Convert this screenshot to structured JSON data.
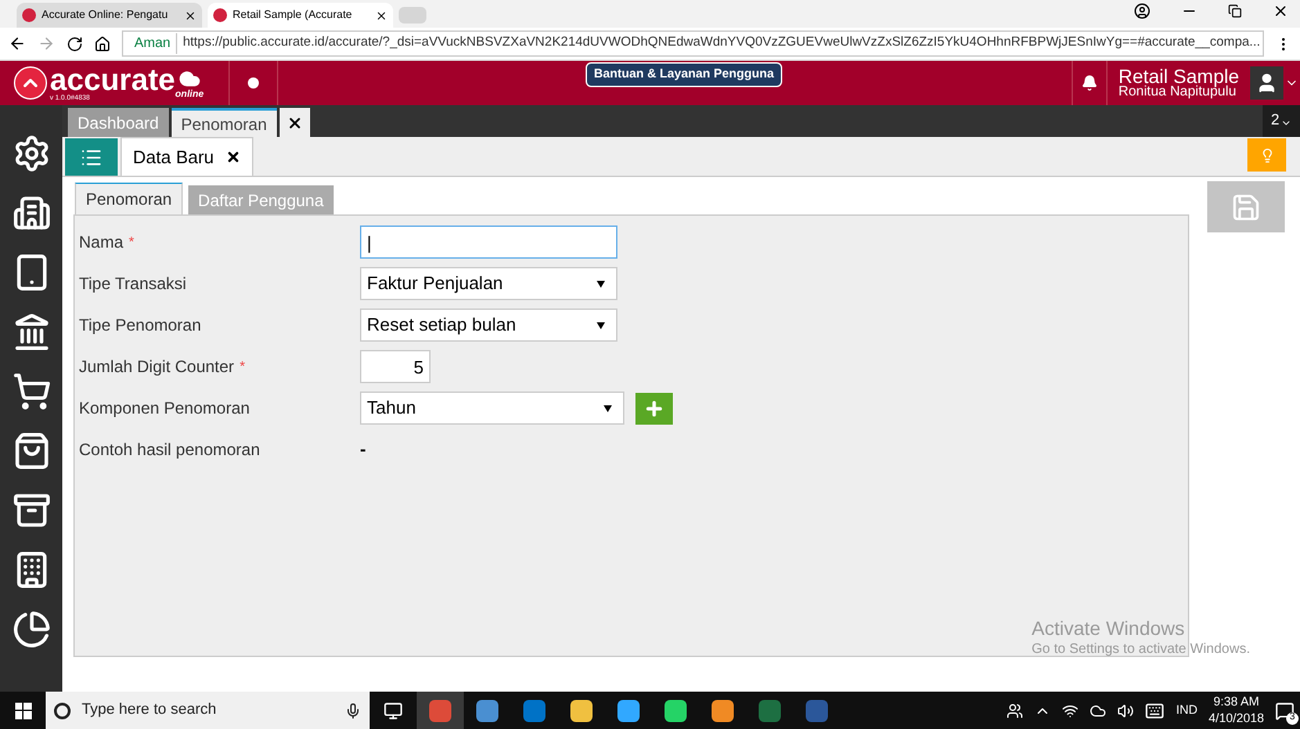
{
  "browser": {
    "tabs": [
      {
        "title": "Accurate Online: Pengatu",
        "selected": false
      },
      {
        "title": "Retail Sample (Accurate",
        "selected": true
      }
    ],
    "secure_label": "Aman",
    "url": "https://public.accurate.id/accurate/?_dsi=aVVuckNBSVZXaVN2K214dUVWODhQNEdwaWdnYVQ0VzZGUEVweUlwVzZxSlZ6ZzI5YkU4OHhnRFBPWjJESnIwYg==#accurate__compa..."
  },
  "header": {
    "logo": "accurate",
    "logo_sub": "online",
    "version": "v 1.0.0#4838",
    "help_button": "Bantuan & Layanan Pengguna",
    "company": "Retail Sample",
    "user": "Ronitua Napitupulu"
  },
  "module_tabs": [
    {
      "label": "Dashboard",
      "selected": false
    },
    {
      "label": "Penomoran",
      "selected": true
    }
  ],
  "module_tab_count": "2",
  "sub_tabs": [
    {
      "label": "Data Baru",
      "selected": true
    }
  ],
  "form_tabs": [
    {
      "label": "Penomoran",
      "selected": true
    },
    {
      "label": "Daftar Pengguna",
      "selected": false
    }
  ],
  "fields": [
    {
      "kind": "text",
      "label": "Nama",
      "marker": "*",
      "value": "|"
    },
    {
      "kind": "select",
      "label": "Tipe Transaksi",
      "value": "Faktur Penjualan"
    },
    {
      "kind": "select",
      "label": "Tipe Penomoran",
      "value": "Reset setiap bulan"
    },
    {
      "kind": "number",
      "label": "Jumlah Digit Counter",
      "marker": "*",
      "value": "5"
    },
    {
      "kind": "select_add",
      "label": "Komponen Penomoran",
      "value": "Tahun"
    },
    {
      "kind": "display",
      "label": "Contoh hasil penomoran",
      "value": "-"
    }
  ],
  "activation": {
    "title": "Activate Windows",
    "subtitle": "Go to Settings to activate Windows."
  },
  "taskbar": {
    "search_placeholder": "Type here to search",
    "language": "IND",
    "time": "9:38 AM",
    "date": "4/10/2018",
    "notifications": "3"
  }
}
